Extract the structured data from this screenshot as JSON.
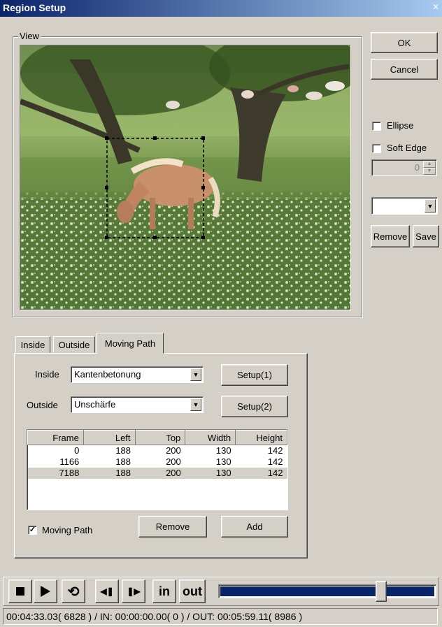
{
  "window": {
    "title": "Region Setup"
  },
  "view": {
    "group_label": "View"
  },
  "buttons": {
    "ok": "OK",
    "cancel": "Cancel",
    "remove": "Remove",
    "save": "Save"
  },
  "options": {
    "ellipse_label": "Ellipse",
    "ellipse_checked": false,
    "soft_edge_label": "Soft Edge",
    "soft_edge_checked": false,
    "spin_value": "0",
    "preset_value": ""
  },
  "tabs": [
    {
      "label": "Inside",
      "active": false
    },
    {
      "label": "Outside",
      "active": false
    },
    {
      "label": "Moving Path",
      "active": true
    }
  ],
  "moving_path": {
    "inside_label": "Inside",
    "inside_value": "Kantenbetonung",
    "setup1": "Setup(1)",
    "outside_label": "Outside",
    "outside_value": "Unschärfe",
    "setup2": "Setup(2)",
    "columns": [
      "Frame",
      "Left",
      "Top",
      "Width",
      "Height"
    ],
    "rows": [
      [
        "0",
        "188",
        "200",
        "130",
        "142"
      ],
      [
        "1166",
        "188",
        "200",
        "130",
        "142"
      ],
      [
        "7188",
        "188",
        "200",
        "130",
        "142"
      ]
    ],
    "selected_row": 2,
    "checkbox_label": "Moving Path",
    "checkbox_checked": true,
    "remove": "Remove",
    "add": "Add"
  },
  "transport": {
    "in_label": "in",
    "out_label": "out",
    "position_fraction": 0.76
  },
  "status": {
    "text": "00:04:33.03( 6828 ) / IN: 00:00:00.00( 0 ) / OUT: 00:05:59.11( 8986 )"
  }
}
